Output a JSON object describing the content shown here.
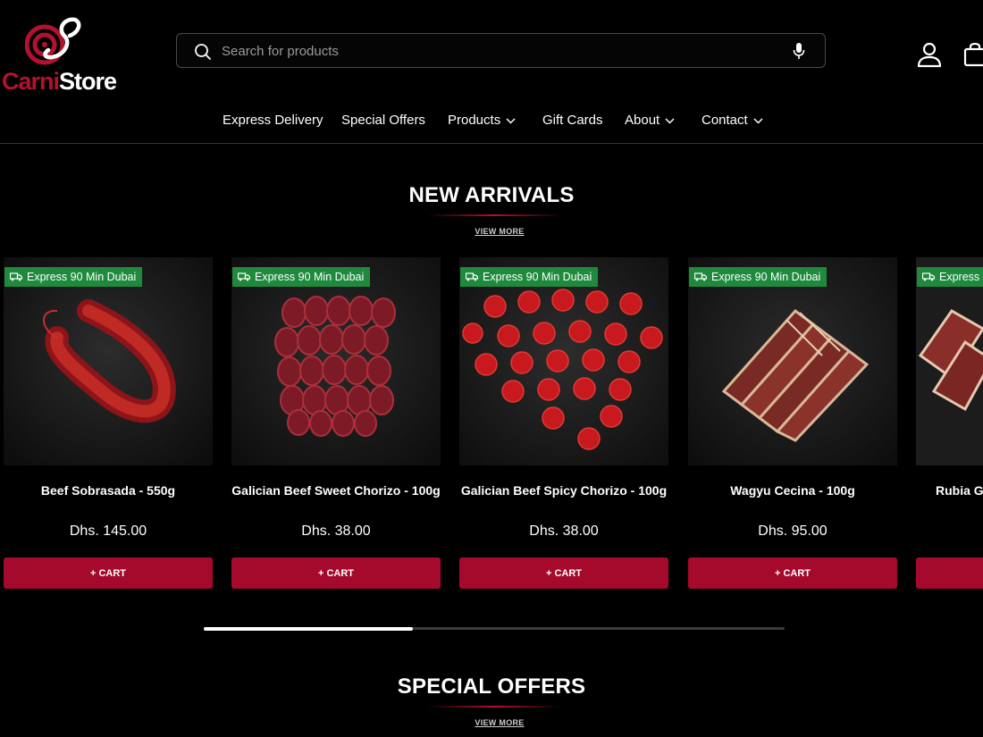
{
  "brand": {
    "logo_part1": "Carni",
    "logo_part2": "Store",
    "accent": "#b3122e"
  },
  "search": {
    "placeholder": "Search for products"
  },
  "header_icons": [
    "search-icon",
    "microphone-icon",
    "account-icon",
    "shopping-bag-icon"
  ],
  "nav": {
    "items": [
      {
        "label": "Express Delivery",
        "dropdown": false
      },
      {
        "label": "Special Offers",
        "dropdown": false
      },
      {
        "label": "Products",
        "dropdown": true
      },
      {
        "label": "Gift Cards",
        "dropdown": false
      },
      {
        "label": "About",
        "dropdown": true
      },
      {
        "label": "Contact",
        "dropdown": true
      }
    ]
  },
  "new_arrivals": {
    "title": "NEW ARRIVALS",
    "view_more": "VIEW MORE",
    "products": [
      {
        "badge": "Express 90 Min Dubai",
        "name": "Beef Sobrasada - 550g",
        "price": "Dhs. 145.00",
        "cart": "+ CART"
      },
      {
        "badge": "Express 90 Min Dubai",
        "name": "Galician Beef Sweet Chorizo - 100g",
        "price": "Dhs. 38.00",
        "cart": "+ CART"
      },
      {
        "badge": "Express 90 Min Dubai",
        "name": "Galician Beef Spicy Chorizo - 100g",
        "price": "Dhs. 38.00",
        "cart": "+ CART"
      },
      {
        "badge": "Express 90 Min Dubai",
        "name": "Wagyu Cecina - 100g",
        "price": "Dhs. 95.00",
        "cart": "+ CART"
      },
      {
        "badge": "Express",
        "name": "Rubia G",
        "price": "",
        "cart": ""
      }
    ],
    "scroll_progress": 0.36
  },
  "special_offers": {
    "title": "SPECIAL OFFERS",
    "view_more": "VIEW MORE"
  },
  "colors": {
    "badge": "#1f8a3d",
    "cart_button": "#a50a2d",
    "background": "#000000"
  }
}
